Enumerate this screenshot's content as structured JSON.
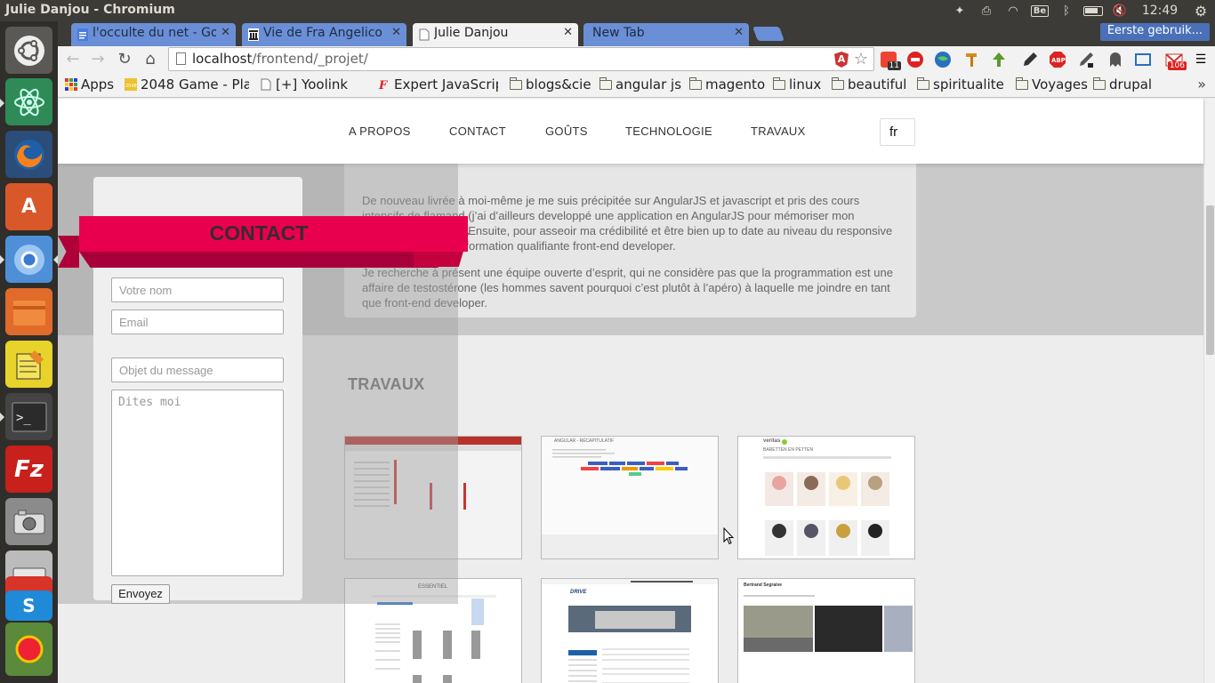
{
  "os": {
    "window_title": "Julie Danjou - Chromium",
    "keyboard_layout": "Be",
    "clock": "12:49"
  },
  "browser": {
    "tabs": [
      {
        "title": "l'occulte du net - Goo",
        "icon": "google-docs-icon"
      },
      {
        "title": "Vie de Fra Angelico c",
        "icon": "museum-icon"
      },
      {
        "title": "Julie Danjou",
        "icon": "page-icon"
      },
      {
        "title": "New Tab",
        "icon": ""
      }
    ],
    "profile": "Eerste gebruik...",
    "url_host": "localhost",
    "url_path": "/frontend/_projet/",
    "extension_badges": {
      "feedly": "11",
      "gmail": "106"
    },
    "bookmarks": [
      {
        "label": "Apps",
        "icon": "apps-grid-icon"
      },
      {
        "label": "2048 Game - Play",
        "icon": "2048-icon"
      },
      {
        "label": "[+] Yoolink",
        "icon": "page-icon"
      },
      {
        "label": "",
        "icon": "page-icon"
      },
      {
        "label": "Expert JavaScript",
        "icon": "f-icon"
      },
      {
        "label": "blogs&cie",
        "icon": "folder-icon"
      },
      {
        "label": "angular js",
        "icon": "folder-icon"
      },
      {
        "label": "magento",
        "icon": "folder-icon"
      },
      {
        "label": "linux",
        "icon": "folder-icon"
      },
      {
        "label": "beautiful",
        "icon": "folder-icon"
      },
      {
        "label": "spiritualite",
        "icon": "folder-icon"
      },
      {
        "label": "Voyages",
        "icon": "folder-icon"
      },
      {
        "label": "drupal",
        "icon": "folder-icon"
      }
    ]
  },
  "site": {
    "nav": [
      "A PROPOS",
      "CONTACT",
      "GOÛTS",
      "TECHNOLOGIE",
      "TRAVAUX"
    ],
    "lang": "fr",
    "about_paragraphs": [
      "De nouveau livrée à moi-même je me suis précipitée sur AngularJS et javascript et pris des cours intensifs de flamand (j’ai d’ailleurs developpé une application en AngularJS pour mémoriser mon Internet Nederland). Ensuite, pour asseoir ma crédibilité et être bien up to date au niveau du responsive design j’ai suivi une formation qualifiante front-end developer.",
      "Je recherche à présent une équipe ouverte d’esprit, qui ne considère pas que la programmation est une affaire de testostérone (les hommes savent pourquoi c’est plutôt à l’apéro) à laquelle me joindre en tant que front-end developer."
    ],
    "travaux_title": "TRAVAUX",
    "thumb_labels": {
      "angular": "ANGULAR - RÉCAPITULATIF",
      "veritas": "veritas",
      "veritas_heading": "BARETTEN EN PETTEN",
      "essentiel": "ESSENTIEL",
      "drive": "DRIVE",
      "photo_title": "Bertrand Segraive"
    },
    "contact": {
      "title": "CONTACT",
      "name_placeholder": "Votre nom",
      "email_placeholder": "Email",
      "subject_placeholder": "Objet du message",
      "message_placeholder": "Dites moi",
      "submit": "Envoyez"
    }
  },
  "colors": {
    "ribbon": "#e8004f",
    "ribbon_dark": "#a8003a",
    "tab_blue": "#6a8fd6"
  }
}
